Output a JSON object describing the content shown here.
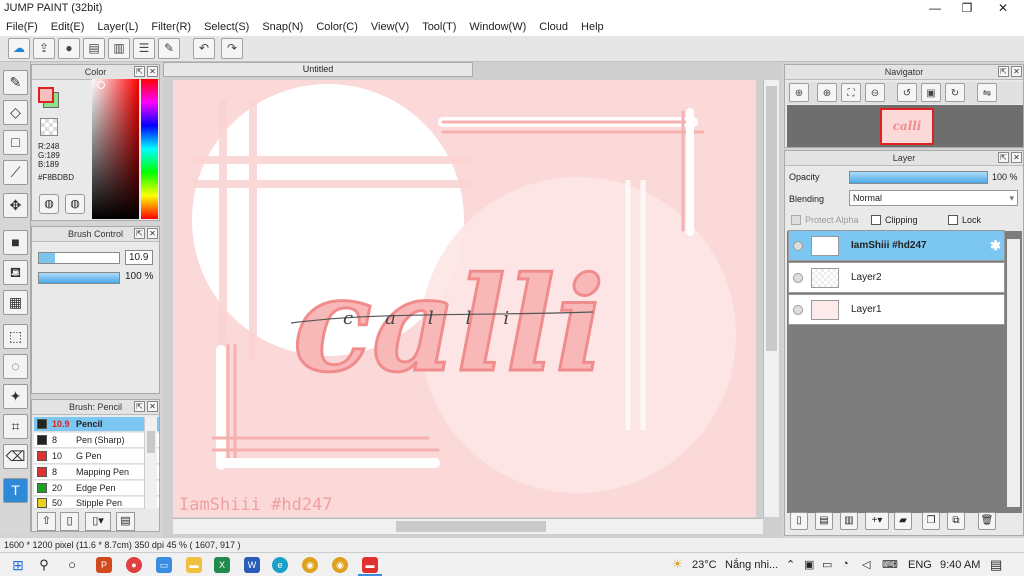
{
  "window": {
    "title": "JUMP PAINT (32bit)",
    "minimize": "—",
    "maximize": "❐",
    "close": "✕"
  },
  "menu": [
    "File(F)",
    "Edit(E)",
    "Layer(L)",
    "Filter(R)",
    "Select(S)",
    "Snap(N)",
    "Color(C)",
    "View(V)",
    "Tool(T)",
    "Window(W)",
    "Cloud",
    "Help"
  ],
  "color_panel": {
    "title": "Color",
    "r": "R:248",
    "g": "G:189",
    "b": "B:189",
    "hex": "#F8BDBD",
    "main_color": "#f8bdbd",
    "sub_color": "#8fe08a"
  },
  "brush_control": {
    "title": "Brush Control",
    "size": "10.9",
    "opacity": "100 %"
  },
  "brush_list": {
    "title": "Brush: Pencil",
    "items": [
      {
        "size": "10.9",
        "name": "Pencil",
        "color": "#222222"
      },
      {
        "size": "8",
        "name": "Pen (Sharp)",
        "color": "#222222"
      },
      {
        "size": "10",
        "name": "G Pen",
        "color": "#e03030"
      },
      {
        "size": "8",
        "name": "Mapping Pen",
        "color": "#e03030"
      },
      {
        "size": "20",
        "name": "Edge Pen",
        "color": "#20a020"
      },
      {
        "size": "50",
        "name": "Stipple Pen",
        "color": "#e8d020"
      }
    ]
  },
  "document": {
    "tab": "Untitled",
    "script_text": "calli",
    "watermark": "IamShiii #hd247"
  },
  "navigator": {
    "title": "Navigator"
  },
  "layer_panel": {
    "title": "Layer",
    "opacity_label": "Opacity",
    "opacity_value": "100 %",
    "blending_label": "Blending",
    "blending_value": "Normal",
    "protect_alpha": "Protect Alpha",
    "clipping": "Clipping",
    "lock": "Lock",
    "layers": [
      "IamShiii #hd247",
      "Layer2",
      "Layer1"
    ]
  },
  "status": "1600 * 1200 pixel  (11.6 * 8.7cm)  350 dpi  45 %  ( 1607, 917 )",
  "taskbar": {
    "weather_temp": "23°C",
    "weather_text": "Nắng nhi...",
    "lang": "ENG",
    "time": "9:40 AM"
  }
}
